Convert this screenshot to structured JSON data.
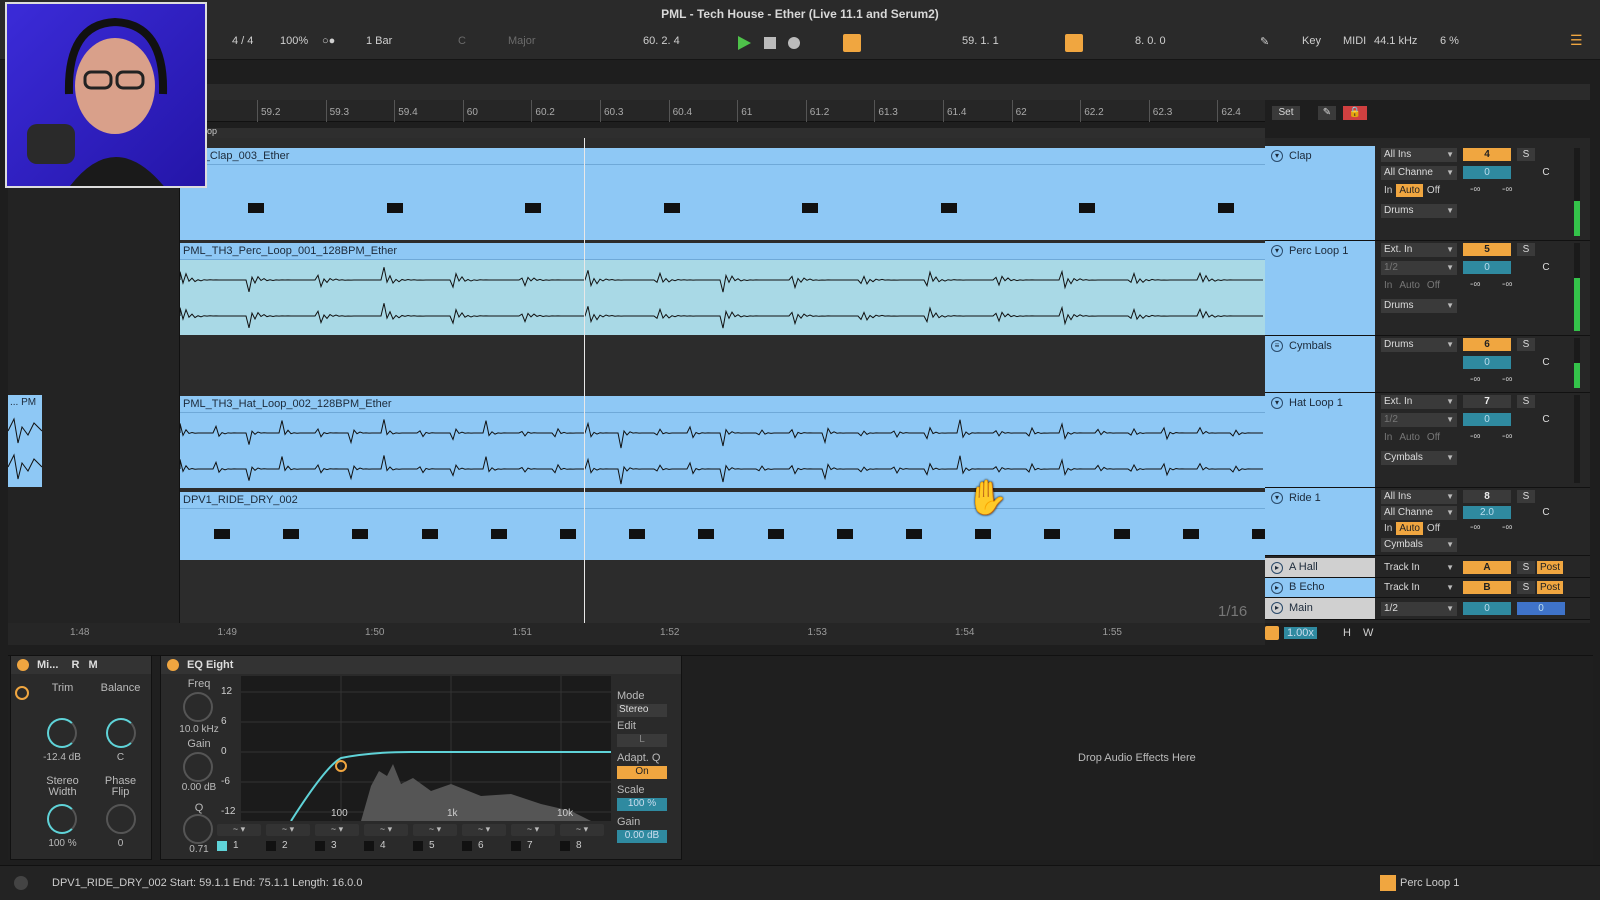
{
  "window": {
    "title": "PML - Tech House - Ether (Live 11.1 and Serum2)"
  },
  "transport": {
    "time_sig": "4 / 4",
    "zoom": "100%",
    "quantize": "1 Bar",
    "key_root": "C",
    "scale": "Major",
    "position": "60.  2.  4",
    "loop_start": "59.  1.  1",
    "loop_length": "8.  0.  0",
    "key_label": "Key",
    "midi_label": "MIDI",
    "sample_rate": "44.1 kHz",
    "cpu": "6 %"
  },
  "ruler": {
    "ticks": [
      "59.2",
      "59.3",
      "59.4",
      "60",
      "60.2",
      "60.3",
      "60.4",
      "61",
      "61.2",
      "61.3",
      "61.4",
      "62",
      "62.2",
      "62.3",
      "62.4"
    ],
    "set_label": "Set"
  },
  "clips": {
    "top_label": "op",
    "clap": "TH3_Clap_003_Ether",
    "perc": "PML_TH3_Perc_Loop_001_128BPM_Ether",
    "hat": "PML_TH3_Hat_Loop_002_128BPM_Ether",
    "ride": "DPV1_RIDE_DRY_002",
    "left_stub": "... PM"
  },
  "bottom_ruler": {
    "ticks": [
      "1:48",
      "1:49",
      "1:50",
      "1:51",
      "1:52",
      "1:53",
      "1:54",
      "1:55"
    ],
    "grid": "1/16"
  },
  "tracks": [
    {
      "name": "Clap",
      "input": "All Ins",
      "channel": "All Channe",
      "mon_in": "In",
      "mon_auto": "Auto",
      "mon_off": "Off",
      "route": "Drums",
      "number": "4",
      "volume": "0",
      "pan": "C",
      "solo": "S",
      "peak_a": "-∞",
      "peak_b": "-∞"
    },
    {
      "name": "Perc Loop 1",
      "input": "Ext. In",
      "channel": "1/2",
      "mon_in": "In",
      "mon_auto": "Auto",
      "mon_off": "Off",
      "route": "Drums",
      "number": "5",
      "volume": "0",
      "pan": "C",
      "solo": "S",
      "peak_a": "-∞",
      "peak_b": "-∞"
    },
    {
      "name": "Cymbals",
      "route": "Drums",
      "number": "6",
      "volume": "0",
      "pan": "C",
      "solo": "S",
      "peak_a": "-∞",
      "peak_b": "-∞"
    },
    {
      "name": "Hat Loop 1",
      "input": "Ext. In",
      "channel": "1/2",
      "mon_in": "In",
      "mon_auto": "Auto",
      "mon_off": "Off",
      "route": "Cymbals",
      "number": "7",
      "volume": "0",
      "pan": "C",
      "solo": "S",
      "peak_a": "-∞",
      "peak_b": "-∞"
    },
    {
      "name": "Ride 1",
      "input": "All Ins",
      "channel": "All Channe",
      "mon_in": "In",
      "mon_auto": "Auto",
      "mon_off": "Off",
      "route": "Cymbals",
      "number": "8",
      "volume": "2.0",
      "pan": "C",
      "solo": "S",
      "peak_a": "-∞",
      "peak_b": "-∞"
    }
  ],
  "returns": [
    {
      "name": "A Hall",
      "input": "Track In",
      "letter": "A",
      "solo": "S",
      "post": "Post"
    },
    {
      "name": "B Echo",
      "input": "Track In",
      "letter": "B",
      "solo": "S",
      "post": "Post"
    },
    {
      "name": "Main",
      "input": "1/2",
      "volume": "0",
      "pan": "0"
    }
  ],
  "zoom_readout": "1.00x",
  "h_label": "H",
  "w_label": "W",
  "device_mixer": {
    "title": "Mi...",
    "r": "R",
    "m": "M",
    "trim_label": "Trim",
    "trim_value": "-12.4 dB",
    "balance_label": "Balance",
    "balance_value": "C",
    "width_label": "Stereo\nWidth",
    "width_value": "100 %",
    "phase_label": "Phase\nFlip",
    "phase_value": "0"
  },
  "eq": {
    "title": "EQ Eight",
    "freq_label": "Freq",
    "freq_value": "10.0 kHz",
    "gain_label": "Gain",
    "gain_value": "0.00 dB",
    "q_label": "Q",
    "q_value": "0.71",
    "db_ticks": [
      "12",
      "6",
      "0",
      "-6",
      "-12"
    ],
    "freq_ticks": [
      "100",
      "1k",
      "10k"
    ],
    "mode_label": "Mode",
    "mode_value": "Stereo",
    "edit_label": "Edit",
    "edit_value": "L",
    "adapt_label": "Adapt. Q",
    "adapt_value": "On",
    "scale_label": "Scale",
    "scale_value": "100 %",
    "out_gain_label": "Gain",
    "out_gain_value": "0.00 dB",
    "bands": [
      "1",
      "2",
      "3",
      "4",
      "5",
      "6",
      "7",
      "8"
    ]
  },
  "drop_fx": "Drop Audio Effects Here",
  "status": {
    "text": "DPV1_RIDE_DRY_002  Start: 59.1.1  End: 75.1.1  Length: 16.0.0",
    "track": "Perc Loop 1"
  },
  "colors": {
    "clip": "#8ec8f5",
    "accent": "#f0a640",
    "volume": "#2f8aa0",
    "meter": "#34c24a"
  }
}
